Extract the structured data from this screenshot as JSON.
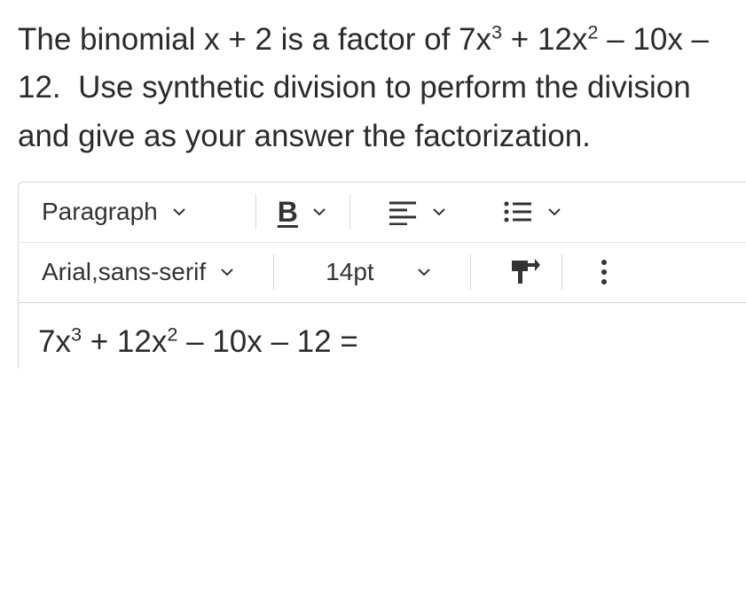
{
  "question": {
    "text_html": "The binomial x + 2 is a factor of 7x<sup>3</sup> + 12x<sup>2</sup> – 10x – 12.&nbsp; Use synthetic division to perform the division and give as your answer the factorization."
  },
  "toolbar": {
    "row1": {
      "block_format": "Paragraph",
      "bold_label": "B"
    },
    "row2": {
      "font_family": "Arial,sans-serif",
      "font_size": "14pt"
    }
  },
  "editor": {
    "content_html": "7x<sup>3</sup> + 12x<sup>2</sup> – 10x – 12 ="
  }
}
